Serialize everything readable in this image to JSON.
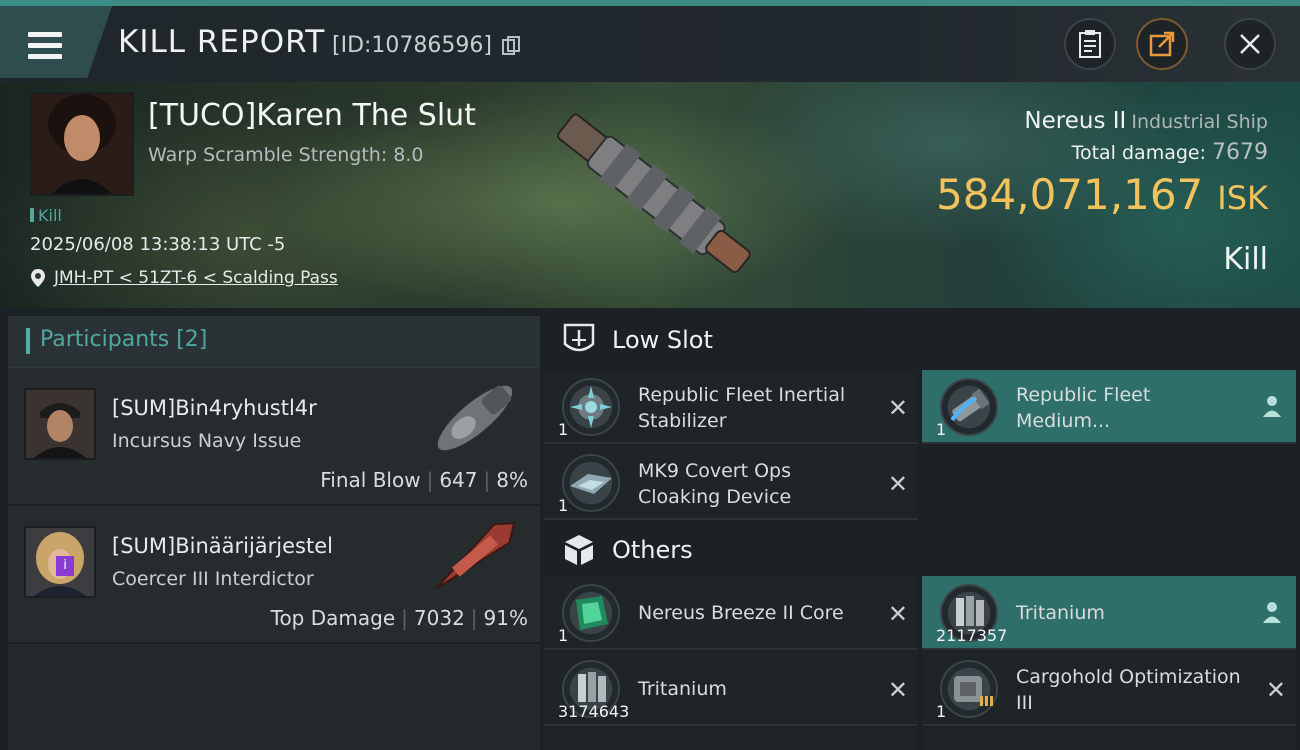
{
  "header": {
    "title": "KILL REPORT",
    "id_label": "[ID:10786596]",
    "icons": [
      "menu-icon",
      "copy-icon",
      "clipboard-icon",
      "share-icon",
      "close-icon"
    ]
  },
  "victim": {
    "name": "[TUCO]Karen The Slut",
    "warp_scramble": "Warp Scramble Strength: 8.0",
    "kill_tag": "Kill",
    "date": "2025/06/08 13:38:13 UTC -5",
    "location": "JMH-PT < 51ZT-6 < Scalding Pass"
  },
  "ship": {
    "name": "Nereus II",
    "class": "Industrial Ship",
    "total_damage_label": "Total damage:",
    "total_damage": "7679",
    "isk_value": "584,071,167",
    "isk_unit": "ISK",
    "result": "Kill"
  },
  "participants": {
    "label": "Participants [2]",
    "list": [
      {
        "name": "[SUM]Bin4ryhustl4r",
        "ship": "Incursus Navy Issue",
        "role": "Final Blow",
        "damage": "647",
        "percent": "8%"
      },
      {
        "name": "[SUM]Binäärijärjestel",
        "ship": "Coercer III Interdictor",
        "role": "Top Damage",
        "damage": "7032",
        "percent": "91%"
      }
    ]
  },
  "low_slot": {
    "label": "Low Slot",
    "items": [
      {
        "name": "Republic Fleet Inertial Stabilizer",
        "qty": "1",
        "status": "destroyed"
      },
      {
        "name": "Republic Fleet Medium...",
        "qty": "1",
        "status": "dropped"
      },
      {
        "name": "MK9 Covert Ops Cloaking Device",
        "qty": "1",
        "status": "destroyed"
      }
    ]
  },
  "others": {
    "label": "Others",
    "items": [
      {
        "name": "Nereus Breeze II Core",
        "qty": "1",
        "status": "destroyed"
      },
      {
        "name": "Tritanium",
        "qty": "2117357",
        "status": "dropped"
      },
      {
        "name": "Tritanium",
        "qty": "3174643",
        "status": "destroyed"
      },
      {
        "name": "Cargohold Optimization III",
        "qty": "1",
        "status": "destroyed"
      }
    ]
  },
  "colors": {
    "accent": "#4fb1a6",
    "isk": "#f2c35c",
    "highlight": "#2f6f6a"
  }
}
